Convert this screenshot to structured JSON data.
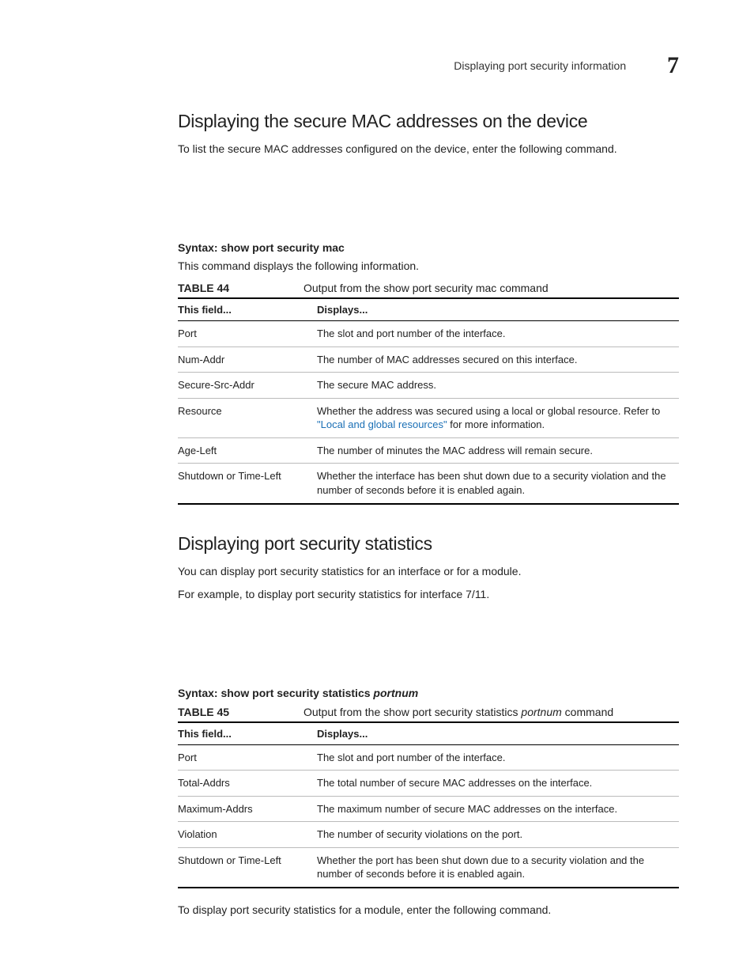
{
  "header": {
    "section_title": "Displaying port security information",
    "chapter_number": "7"
  },
  "section1": {
    "heading": "Displaying the secure MAC addresses on the device",
    "intro": "To list the secure MAC addresses configured on the device, enter the following command.",
    "syntax_label": "Syntax:",
    "syntax_cmd": "show port security mac",
    "after_syntax": "This command displays the following information.",
    "table_label": "TABLE 44",
    "table_caption": "Output from the show port security mac command",
    "th_field": "This field...",
    "th_displays": "Displays...",
    "rows": [
      {
        "field": "Port",
        "displays_pre": "The slot and port number of the interface."
      },
      {
        "field": "Num-Addr",
        "displays_pre": "The number of MAC addresses secured on this interface."
      },
      {
        "field": "Secure-Src-Addr",
        "displays_pre": "The secure MAC address."
      },
      {
        "field": "Resource",
        "displays_pre": "Whether the address was secured using a local or global resource. Refer to ",
        "link_text": "\"Local and global resources\"",
        "displays_post": " for more information."
      },
      {
        "field": "Age-Left",
        "displays_pre": "The number of minutes the MAC address will remain secure."
      },
      {
        "field": "Shutdown or Time-Left",
        "displays_pre": "Whether the interface has been shut down due to a security violation and the number of seconds before it is enabled again."
      }
    ]
  },
  "section2": {
    "heading": "Displaying port security statistics",
    "intro1": "You can display port security statistics for an interface or for a module.",
    "intro2": "For example, to display port security statistics for interface 7/11.",
    "syntax_label": "Syntax:",
    "syntax_cmd": "show port security statistics",
    "syntax_arg": "portnum",
    "table_label": "TABLE 45",
    "table_caption_pre": "Output from the show port security statistics ",
    "table_caption_arg": "portnum",
    "table_caption_post": " command",
    "th_field": "This field...",
    "th_displays": "Displays...",
    "rows": [
      {
        "field": "Port",
        "displays": "The slot and port number of the interface."
      },
      {
        "field": "Total-Addrs",
        "displays": "The total number of secure MAC addresses on the interface."
      },
      {
        "field": "Maximum-Addrs",
        "displays": "The maximum number of secure MAC addresses on the interface."
      },
      {
        "field": "Violation",
        "displays": "The number of security violations on the port."
      },
      {
        "field": "Shutdown or Time-Left",
        "displays": "Whether the port has been shut down due to a security violation and the number of seconds before it is enabled again."
      }
    ],
    "outro": "To display port security statistics for a module, enter the following command."
  }
}
